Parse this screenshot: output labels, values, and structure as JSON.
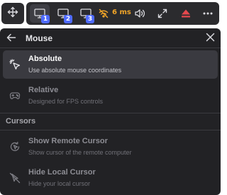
{
  "toolbar": {
    "monitors": [
      {
        "badge": "1",
        "active": true
      },
      {
        "badge": "2",
        "active": false
      },
      {
        "badge": "3",
        "active": false
      }
    ],
    "latency": "6 ms",
    "icons": {
      "move": "move-arrows-icon",
      "monitor": "monitor-icon",
      "latency": "no-signal-icon",
      "volume": "volume-icon",
      "fullscreen": "expand-diagonal-icon",
      "eject": "eject-icon",
      "more": "more-dots-icon"
    },
    "colors": {
      "badge": "#4f6bff",
      "latency": "#f0a428",
      "eject": "#e5484d"
    }
  },
  "mouse_menu": {
    "title": "Mouse",
    "options": [
      {
        "title": "Absolute",
        "description": "Use absolute mouse coordinates",
        "selected": true,
        "icon": "cursor-click-icon"
      },
      {
        "title": "Relative",
        "description": "Designed for FPS controls",
        "selected": false,
        "icon": "gamepad-icon"
      }
    ],
    "cursors_section": {
      "label": "Cursors",
      "options": [
        {
          "title": "Show Remote Cursor",
          "description": "Show cursor of the remote computer",
          "icon": "cursor-refresh-icon"
        },
        {
          "title": "Hide Local Cursor",
          "description": "Hide your local cursor",
          "icon": "cursor-hidden-icon"
        }
      ]
    }
  }
}
